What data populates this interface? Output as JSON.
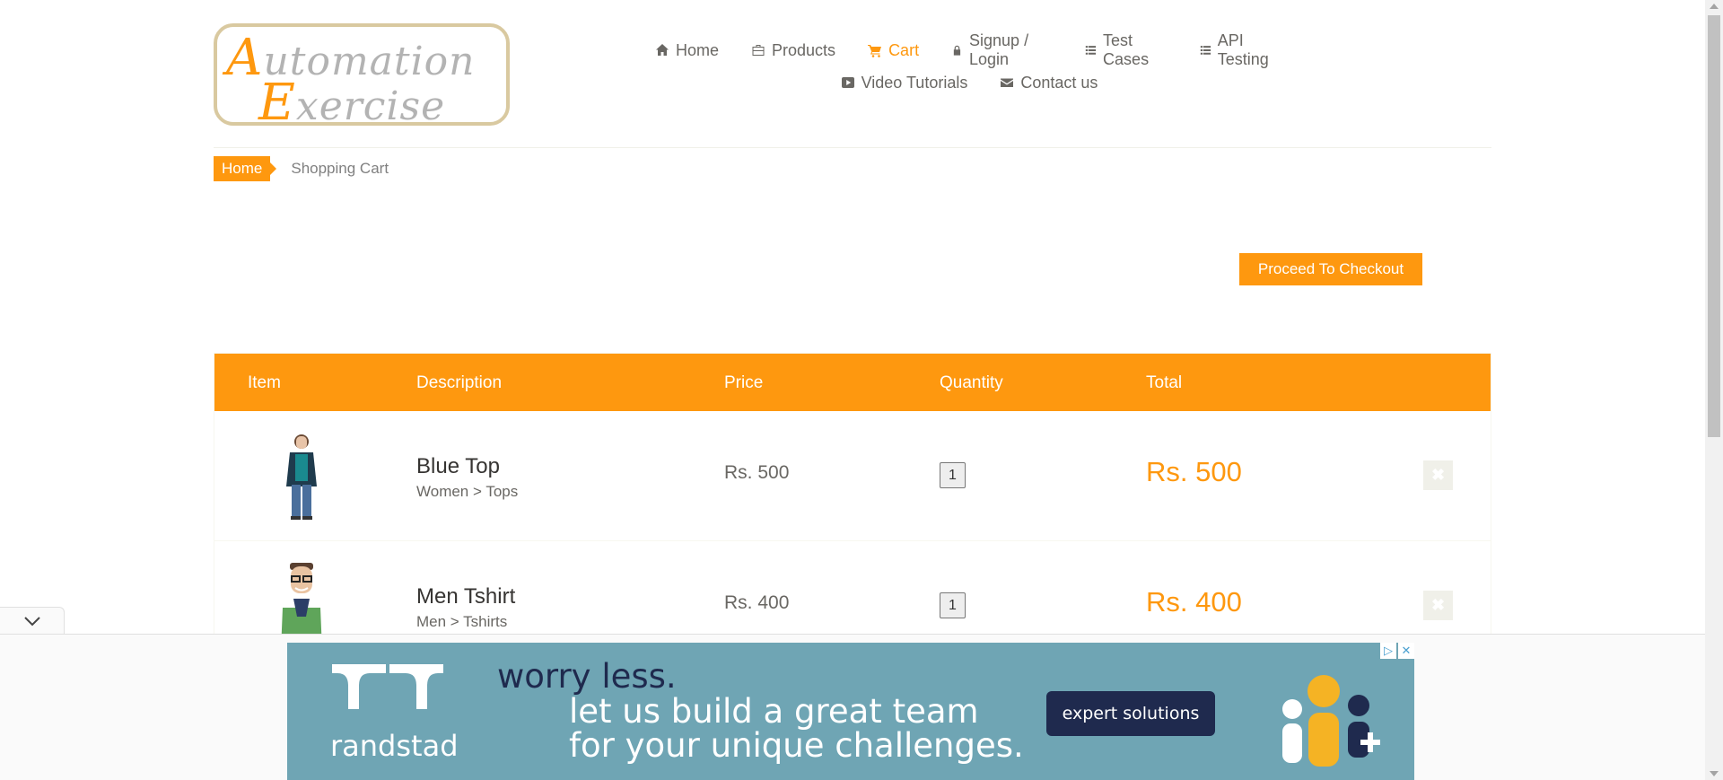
{
  "logo": {
    "line1_cap": "A",
    "line1_rest": "utomation",
    "line2_cap": "E",
    "line2_rest": "xercise"
  },
  "nav": {
    "row1": [
      {
        "label": "Home",
        "icon": "home-icon"
      },
      {
        "label": "Products",
        "icon": "briefcase-icon"
      },
      {
        "label": "Cart",
        "icon": "cart-icon",
        "active": true
      },
      {
        "label": "Signup / Login",
        "icon": "lock-icon"
      },
      {
        "label": "Test Cases",
        "icon": "list-icon"
      },
      {
        "label": "API Testing",
        "icon": "list-icon"
      }
    ],
    "row2": [
      {
        "label": "Video Tutorials",
        "icon": "youtube-icon"
      },
      {
        "label": "Contact us",
        "icon": "envelope-icon"
      }
    ]
  },
  "breadcrumb": {
    "home": "Home",
    "current": "Shopping Cart"
  },
  "checkout_label": "Proceed To Checkout",
  "table": {
    "headers": {
      "item": "Item",
      "description": "Description",
      "price": "Price",
      "quantity": "Quantity",
      "total": "Total"
    },
    "rows": [
      {
        "name": "Blue Top",
        "category": "Women > Tops",
        "price": "Rs. 500",
        "quantity": "1",
        "total": "Rs. 500"
      },
      {
        "name": "Men Tshirt",
        "category": "Men > Tshirts",
        "price": "Rs. 400",
        "quantity": "1",
        "total": "Rs. 400"
      }
    ]
  },
  "ad": {
    "brand": "randstad",
    "tagline1": "worry less.",
    "tagline2": "let us build a great team",
    "tagline3": "for your unique challenges.",
    "cta": "expert solutions",
    "adchoices": "▷",
    "close": "✕"
  },
  "colors": {
    "accent": "#fe980f",
    "text": "#696763",
    "ad_bg": "#6fa5b4",
    "ad_dark": "#1f2a4e"
  }
}
